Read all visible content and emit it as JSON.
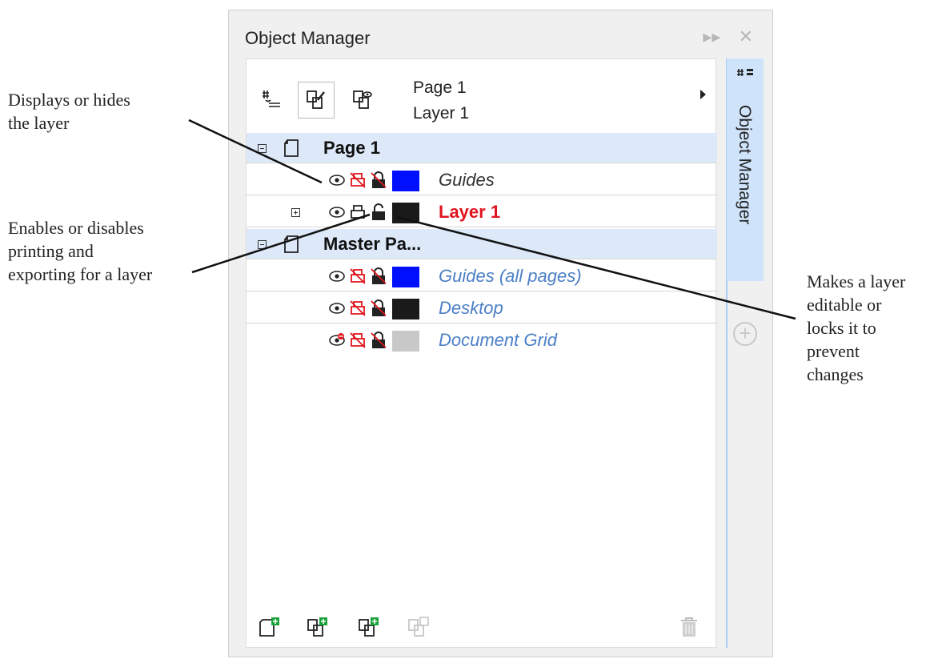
{
  "panel": {
    "title": "Object Manager",
    "side_tab_label": "Object Manager",
    "current_page": "Page 1",
    "current_layer": "Layer 1"
  },
  "title_controls": {
    "expand_glyph": "▸▸",
    "close_glyph": "✕"
  },
  "tree": [
    {
      "type": "page",
      "label": "Page 1"
    },
    {
      "type": "layer",
      "label": "Guides",
      "swatch": "#0010ff",
      "style": "dark"
    },
    {
      "type": "layer",
      "label": "Layer 1",
      "swatch": "#1a1a1a",
      "style": "red"
    },
    {
      "type": "page",
      "label": "Master Pa..."
    },
    {
      "type": "layer",
      "label": "Guides (all pages)",
      "swatch": "#0010ff",
      "style": "blue"
    },
    {
      "type": "layer",
      "label": "Desktop",
      "swatch": "#1a1a1a",
      "style": "blue"
    },
    {
      "type": "layer",
      "label": "Document Grid",
      "swatch": "#c8c8c8",
      "style": "blue"
    }
  ],
  "annotations": {
    "display": "Displays or hides the layer",
    "display_lines": [
      "Displays or hides",
      "the layer"
    ],
    "print_lines": [
      "Enables or disables",
      "printing and",
      "exporting for a layer"
    ],
    "lock_lines": [
      "Makes a layer",
      "editable or",
      "locks it to",
      "prevent",
      "changes"
    ]
  },
  "colors": {
    "accent_red": "#e0141e",
    "header_row": "#dde9f8",
    "side_tab": "#cfe3fb",
    "link_blue": "#4b7fc6"
  },
  "icons": [
    "page-properties-icon",
    "layer-properties-icon",
    "layer-manager-view-icon",
    "new-page-icon",
    "new-layer-icon",
    "new-master-layer-icon",
    "new-master-layer-all-icon",
    "delete-icon"
  ]
}
